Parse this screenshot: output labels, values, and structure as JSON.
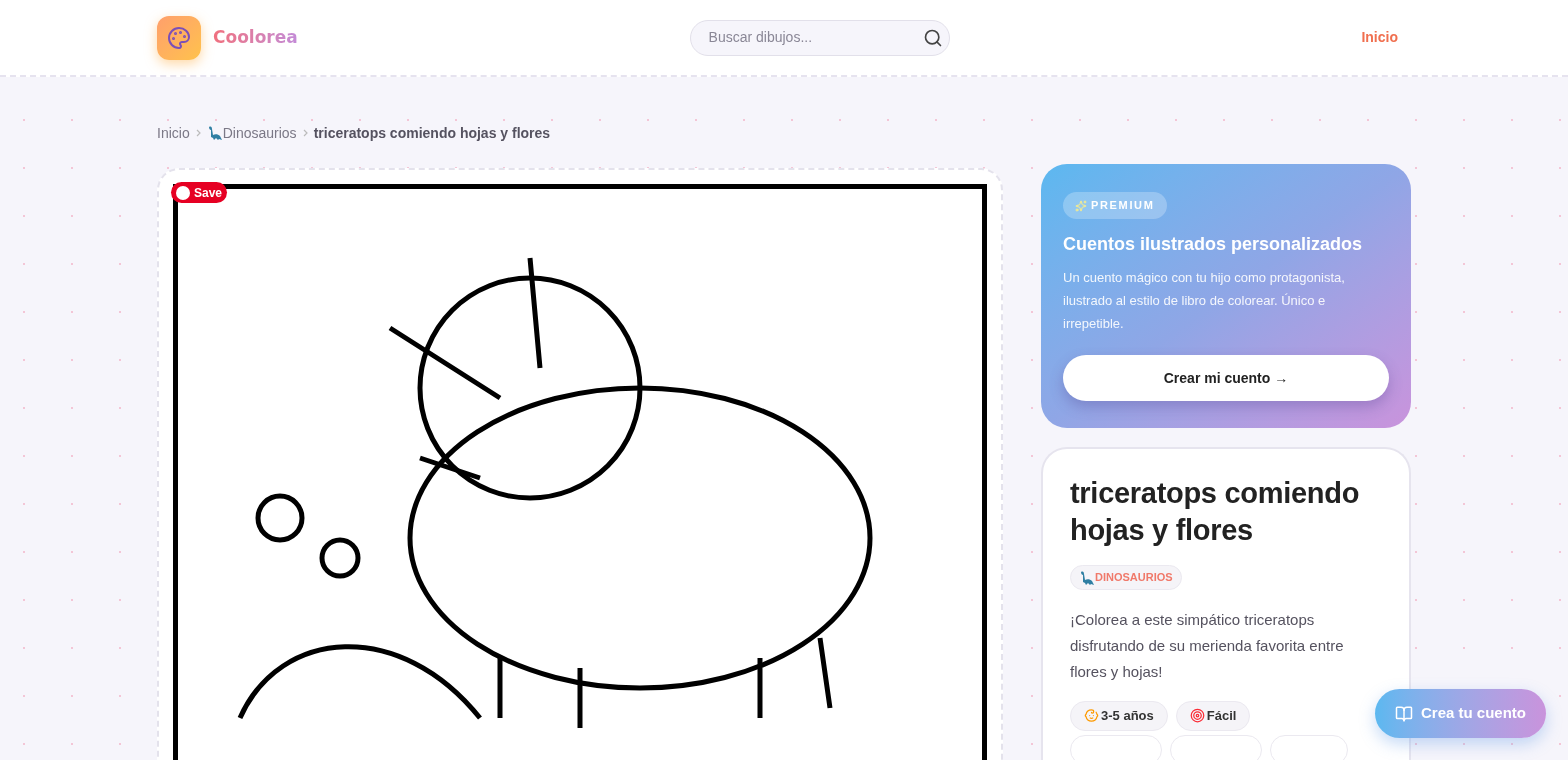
{
  "header": {
    "logo_text": "Coolorea",
    "search": {
      "placeholder": "Buscar dibujos..."
    },
    "nav": [
      {
        "label": "Inicio"
      }
    ]
  },
  "breadcrumb": [
    {
      "label": "Inicio",
      "kind": "link"
    },
    {
      "label": "Dinosaurios",
      "kind": "category"
    },
    {
      "label": "triceratops comiendo hojas y flores",
      "kind": "current"
    }
  ],
  "image": {
    "save_label": "Save"
  },
  "premium": {
    "badge": "PREMIUM",
    "title": "Cuentos ilustrados personalizados",
    "text": "Un cuento mágico con tu hijo como protagonista, ilustrado al estilo de libro de colorear. Único e irrepetible.",
    "button": "Crear mi cuento →"
  },
  "info": {
    "title": "triceratops comiendo hojas y flores",
    "category": "DINOSAURIOS",
    "description": "¡Colorea a este simpático triceratops disfrutando de su merienda favorita entre flores y hojas!",
    "tags": [
      {
        "label": "3-5 años",
        "kind": "age"
      },
      {
        "label": "Fácil",
        "kind": "difficulty"
      }
    ]
  },
  "fab": {
    "label": "Crea tu cuento"
  }
}
